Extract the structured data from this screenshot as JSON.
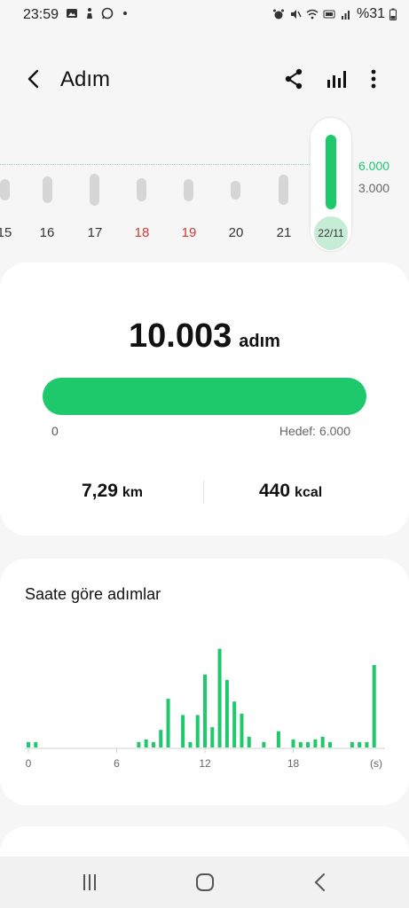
{
  "status_bar": {
    "time": "23:59",
    "left_icons": [
      "gallery-icon",
      "figure-icon",
      "whatsapp-icon",
      "dot-icon"
    ],
    "right_icons": [
      "alarm-icon",
      "mute-icon",
      "wifi-icon",
      "volte-icon",
      "signal-icon"
    ],
    "battery_text": "%31"
  },
  "header": {
    "title": "Adım",
    "icons": [
      "share-icon",
      "bar-chart-icon",
      "more-icon"
    ]
  },
  "week_strip": {
    "gridlines": [
      {
        "label": "6.000",
        "value": 6000
      },
      {
        "label": "3.000",
        "value": 3000
      }
    ],
    "days": [
      {
        "label": "15",
        "steps": 2400,
        "weekend": false,
        "partial": true
      },
      {
        "label": "16",
        "steps": 3000,
        "weekend": false
      },
      {
        "label": "17",
        "steps": 3600,
        "weekend": false
      },
      {
        "label": "18",
        "steps": 2600,
        "weekend": true
      },
      {
        "label": "19",
        "steps": 2500,
        "weekend": true
      },
      {
        "label": "20",
        "steps": 2100,
        "weekend": false
      },
      {
        "label": "21",
        "steps": 3400,
        "weekend": false
      },
      {
        "label": "22/11",
        "steps": 10003,
        "weekend": false,
        "selected": true
      }
    ],
    "accent": "#1ec96b"
  },
  "summary": {
    "steps": "10.003",
    "unit": "adım",
    "progress_fraction": 1.0,
    "progress_start": "0",
    "goal": "Hedef: 6.000",
    "distance_value": "7,29",
    "distance_unit": "km",
    "calories_value": "440",
    "calories_unit": "kcal"
  },
  "hourly": {
    "title": "Saate göre adımlar",
    "chart_data": {
      "type": "bar",
      "xlabel": "(s)",
      "x_ticks": [
        "0",
        "6",
        "12",
        "18"
      ],
      "xlim": [
        0,
        24
      ],
      "values": [
        40,
        40,
        0,
        0,
        0,
        0,
        0,
        0,
        0,
        0,
        0,
        0,
        0,
        0,
        0,
        0,
        0,
        0,
        0,
        0,
        0,
        0,
        0,
        0,
        0,
        0,
        0,
        0,
        0,
        0,
        0,
        0,
        0,
        0,
        0,
        0,
        0,
        0,
        0,
        0,
        0,
        0,
        0,
        0,
        0,
        0,
        0,
        0,
        0,
        0,
        0,
        0,
        0,
        0,
        0,
        0,
        0,
        0,
        0,
        0,
        0,
        0,
        0,
        0,
        0,
        0,
        0,
        0,
        0,
        0,
        0,
        0,
        0,
        0,
        0,
        0,
        0,
        0,
        0,
        0,
        0,
        0,
        0,
        0,
        0,
        0,
        0,
        0,
        0,
        0,
        0,
        0,
        0,
        0,
        0,
        0,
        0,
        0,
        0,
        0,
        0,
        0,
        0,
        0,
        0,
        0,
        0,
        0,
        0,
        0,
        0,
        0,
        0,
        0,
        0,
        0,
        0,
        0,
        0,
        0,
        0,
        0,
        0,
        0,
        0,
        0,
        0,
        0,
        0,
        0,
        0,
        0,
        0,
        0,
        0,
        0,
        0,
        0,
        0,
        0,
        0,
        0,
        0,
        0
      ],
      "bars": [
        {
          "hour": 0.0,
          "value": 40
        },
        {
          "hour": 0.5,
          "value": 40
        },
        {
          "hour": 7.5,
          "value": 40
        },
        {
          "hour": 8.0,
          "value": 60
        },
        {
          "hour": 8.5,
          "value": 40
        },
        {
          "hour": 9.0,
          "value": 130
        },
        {
          "hour": 9.5,
          "value": 360
        },
        {
          "hour": 10.5,
          "value": 240
        },
        {
          "hour": 11.0,
          "value": 40
        },
        {
          "hour": 11.5,
          "value": 240
        },
        {
          "hour": 12.0,
          "value": 540
        },
        {
          "hour": 12.5,
          "value": 150
        },
        {
          "hour": 13.0,
          "value": 730
        },
        {
          "hour": 13.5,
          "value": 500
        },
        {
          "hour": 14.0,
          "value": 340
        },
        {
          "hour": 14.5,
          "value": 250
        },
        {
          "hour": 15.0,
          "value": 80
        },
        {
          "hour": 16.0,
          "value": 40
        },
        {
          "hour": 17.0,
          "value": 120
        },
        {
          "hour": 18.0,
          "value": 60
        },
        {
          "hour": 18.5,
          "value": 40
        },
        {
          "hour": 19.0,
          "value": 40
        },
        {
          "hour": 19.5,
          "value": 60
        },
        {
          "hour": 20.0,
          "value": 80
        },
        {
          "hour": 20.5,
          "value": 40
        },
        {
          "hour": 22.0,
          "value": 40
        },
        {
          "hour": 22.5,
          "value": 40
        },
        {
          "hour": 23.0,
          "value": 40
        },
        {
          "hour": 23.5,
          "value": 610
        }
      ],
      "ylim": [
        0,
        800
      ],
      "color": "#1ec96b"
    }
  },
  "nav_bar": {
    "icons": [
      "recent-apps-icon",
      "home-icon",
      "back-nav-icon"
    ]
  }
}
